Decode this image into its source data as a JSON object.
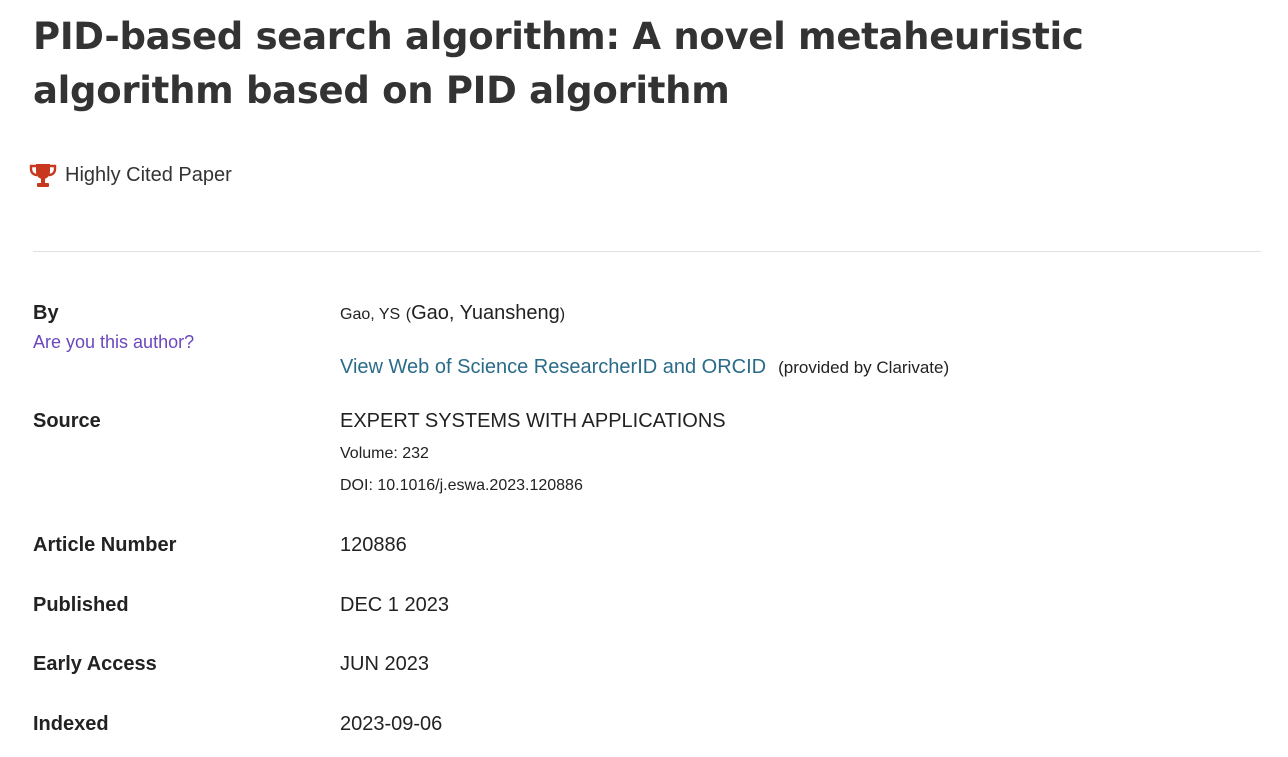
{
  "record": {
    "title": "PID-based search algorithm: A novel metaheuristic algorithm based on PID algorithm",
    "badge": {
      "icon": "trophy-icon",
      "label": "Highly Cited Paper",
      "color": "#c8381e"
    },
    "by": {
      "label": "By",
      "are_you_author": "Are you this author?",
      "author_short": "Gao, YS",
      "author_full_open": "(",
      "author_full": "Gao, Yuansheng",
      "author_full_close": ")",
      "researcher_link": "View Web of Science ResearcherID and ORCID",
      "provided_by": "(provided by Clarivate)"
    },
    "source": {
      "label": "Source",
      "journal": "EXPERT SYSTEMS WITH APPLICATIONS",
      "volume": "Volume: 232",
      "doi_label": "DOI:",
      "doi": "10.1016/j.eswa.2023.120886"
    },
    "article_number": {
      "label": "Article Number",
      "value": "120886"
    },
    "published": {
      "label": "Published",
      "value": "DEC 1 2023"
    },
    "early_access": {
      "label": "Early Access",
      "value": "JUN 2023"
    },
    "indexed": {
      "label": "Indexed",
      "value": "2023-09-06"
    }
  },
  "colors": {
    "title": "#333333",
    "link_purple": "#6b47bd",
    "link_blue": "#2b6b8a",
    "divider": "#e0e0e0"
  }
}
